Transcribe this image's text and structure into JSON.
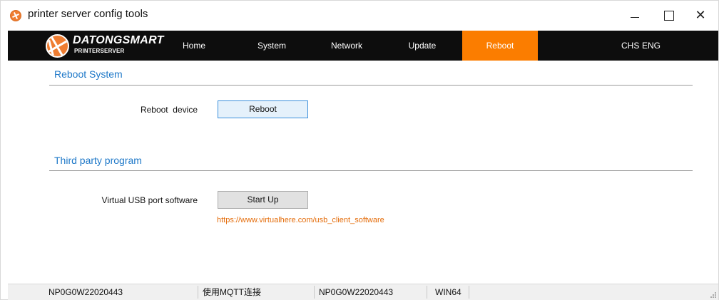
{
  "window": {
    "title": "printer server config tools",
    "controls": {
      "minimize": "—",
      "maximize": "☐",
      "close": "✕"
    }
  },
  "brand": {
    "name": "DATONGSMART",
    "subtitle": "PRINTERSERVER",
    "accent_color": "#fb7d00"
  },
  "nav": {
    "items": [
      {
        "label": "Home"
      },
      {
        "label": "System"
      },
      {
        "label": "Network"
      },
      {
        "label": "Update"
      },
      {
        "label": "Reboot",
        "active": true
      }
    ],
    "languages": [
      "CHS",
      "ENG"
    ]
  },
  "reboot_section": {
    "title": "Reboot System",
    "row_label": "Reboot  device",
    "button_label": "Reboot"
  },
  "third_party_section": {
    "title": "Third party program",
    "row_label": "Virtual USB port software",
    "button_label": "Start Up",
    "link": "https://www.virtualhere.com/usb_client_software"
  },
  "status_bar": {
    "cells": [
      "NP0G0W22020443",
      "使用MQTT连接",
      "NP0G0W22020443",
      "WIN64"
    ]
  },
  "colors": {
    "nav_background": "#0d0d0d",
    "section_title": "#1e78c8",
    "link": "#e46c0a"
  }
}
